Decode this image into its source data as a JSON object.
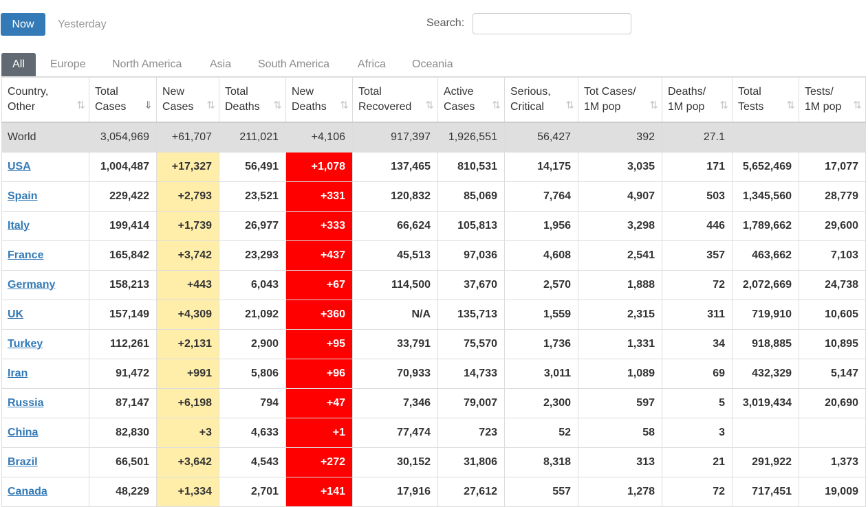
{
  "controls": {
    "now_label": "Now",
    "yesterday_label": "Yesterday",
    "search_label": "Search:",
    "search_value": ""
  },
  "tabs": [
    "All",
    "Europe",
    "North America",
    "Asia",
    "South America",
    "Africa",
    "Oceania"
  ],
  "active_tab": "All",
  "columns": [
    [
      "Country,",
      "Other"
    ],
    [
      "Total",
      "Cases"
    ],
    [
      "New",
      "Cases"
    ],
    [
      "Total",
      "Deaths"
    ],
    [
      "New",
      "Deaths"
    ],
    [
      "Total",
      "Recovered"
    ],
    [
      "Active",
      "Cases"
    ],
    [
      "Serious,",
      "Critical"
    ],
    [
      "Tot Cases/",
      "1M pop"
    ],
    [
      "Deaths/",
      "1M pop"
    ],
    [
      "Total",
      "Tests"
    ],
    [
      "Tests/",
      "1M pop"
    ]
  ],
  "sort_icons": {
    "default": "⇅",
    "active": "⇓"
  },
  "world_row": [
    "World",
    "3,054,969",
    "+61,707",
    "211,021",
    "+4,106",
    "917,397",
    "1,926,551",
    "56,427",
    "392",
    "27.1",
    "",
    ""
  ],
  "rows": [
    [
      "USA",
      "1,004,487",
      "+17,327",
      "56,491",
      "+1,078",
      "137,465",
      "810,531",
      "14,175",
      "3,035",
      "171",
      "5,652,469",
      "17,077"
    ],
    [
      "Spain",
      "229,422",
      "+2,793",
      "23,521",
      "+331",
      "120,832",
      "85,069",
      "7,764",
      "4,907",
      "503",
      "1,345,560",
      "28,779"
    ],
    [
      "Italy",
      "199,414",
      "+1,739",
      "26,977",
      "+333",
      "66,624",
      "105,813",
      "1,956",
      "3,298",
      "446",
      "1,789,662",
      "29,600"
    ],
    [
      "France",
      "165,842",
      "+3,742",
      "23,293",
      "+437",
      "45,513",
      "97,036",
      "4,608",
      "2,541",
      "357",
      "463,662",
      "7,103"
    ],
    [
      "Germany",
      "158,213",
      "+443",
      "6,043",
      "+67",
      "114,500",
      "37,670",
      "2,570",
      "1,888",
      "72",
      "2,072,669",
      "24,738"
    ],
    [
      "UK",
      "157,149",
      "+4,309",
      "21,092",
      "+360",
      "N/A",
      "135,713",
      "1,559",
      "2,315",
      "311",
      "719,910",
      "10,605"
    ],
    [
      "Turkey",
      "112,261",
      "+2,131",
      "2,900",
      "+95",
      "33,791",
      "75,570",
      "1,736",
      "1,331",
      "34",
      "918,885",
      "10,895"
    ],
    [
      "Iran",
      "91,472",
      "+991",
      "5,806",
      "+96",
      "70,933",
      "14,733",
      "3,011",
      "1,089",
      "69",
      "432,329",
      "5,147"
    ],
    [
      "Russia",
      "87,147",
      "+6,198",
      "794",
      "+47",
      "7,346",
      "79,007",
      "2,300",
      "597",
      "5",
      "3,019,434",
      "20,690"
    ],
    [
      "China",
      "82,830",
      "+3",
      "4,633",
      "+1",
      "77,474",
      "723",
      "52",
      "58",
      "3",
      "",
      ""
    ],
    [
      "Brazil",
      "66,501",
      "+3,642",
      "4,543",
      "+272",
      "30,152",
      "31,806",
      "8,318",
      "313",
      "21",
      "291,922",
      "1,373"
    ],
    [
      "Canada",
      "48,229",
      "+1,334",
      "2,701",
      "+141",
      "17,916",
      "27,612",
      "557",
      "1,278",
      "72",
      "717,451",
      "19,009"
    ]
  ]
}
